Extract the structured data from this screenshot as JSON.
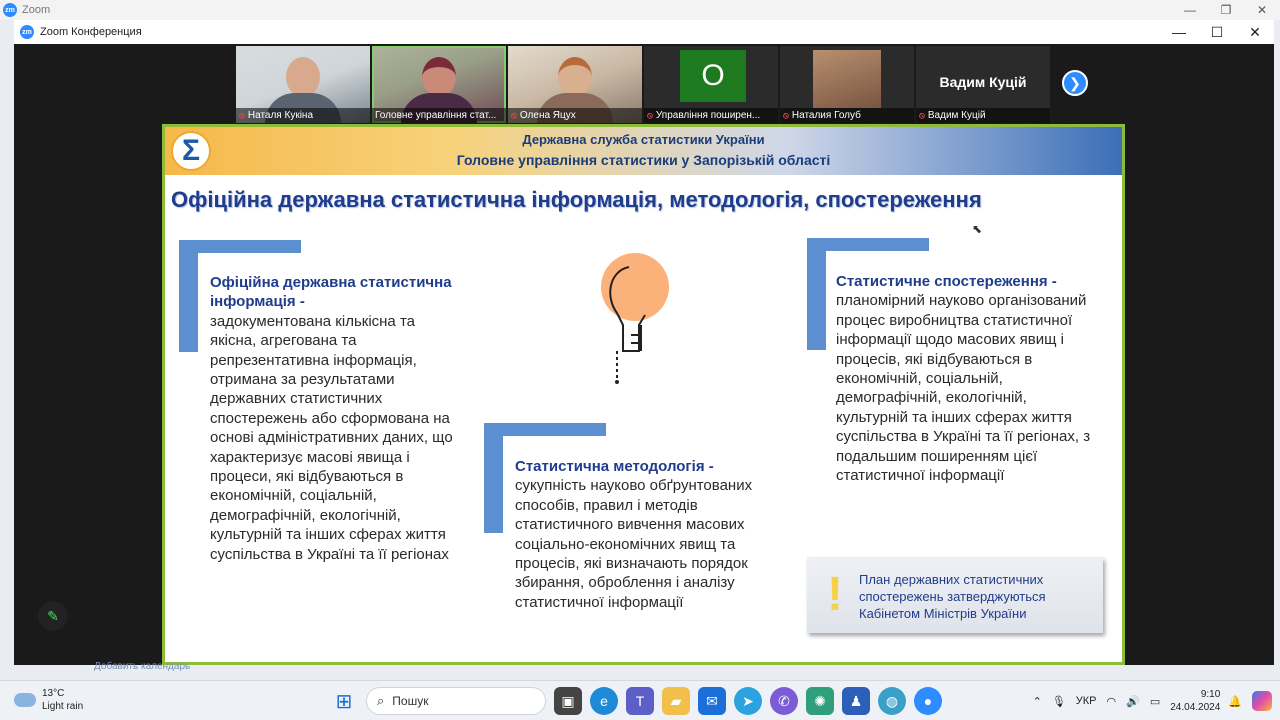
{
  "outer_window": {
    "title": "Zoom"
  },
  "meeting_window": {
    "title": "Zoom Конференция"
  },
  "participants": [
    {
      "name": "Наталя Кукіна"
    },
    {
      "name": "Головне управління стат..."
    },
    {
      "name": "Олена Яцух"
    },
    {
      "name": "Управління поширен...",
      "initial": "О"
    },
    {
      "name": "Наталия Голуб"
    },
    {
      "name": "Вадим Куцій",
      "display_name": "Вадим Куцій"
    }
  ],
  "slide": {
    "org_line1": "Державна служба статистики України",
    "org_line2": "Головне управління статистики у Запорізькій області",
    "title": "Офіційна державна статистична інформація, методологія, спостереження",
    "col1_term": "Офіційна державна статистична інформація -",
    "col1_text": "задокументована кількісна та якісна, агрегована та репрезентативна інформація, отримана за результатами державних статистичних спостережень або сформована на основі адміністративних даних, що характеризує масові явища і процеси, які відбуваються в економічній, соціальній, демографічній, екологічній, культурній та інших сферах життя суспільства в Україні та її регіонах",
    "col2_term": "Статистична методологія -",
    "col2_text": "сукупність науково обґрунтованих способів, правил і методів статистичного вивчення масових соціально-економічних явищ та процесів, які визначають порядок збирання, оброблення і аналізу статистичної інформації",
    "col3_term": "Статистичне спостереження -",
    "col3_text": "планомірний науково організований процес виробництва статистичної інформації щодо масових явищ і процесів, які відбуваються в економічній, соціальній, демографічній, екологічній, культурній та інших сферах життя суспільства в Україні та її регіонах, з подальшим поширенням цієї статистичної інформації",
    "note_text": "План державних статистичних спостережень затверджуються Кабінетом Міністрів України"
  },
  "behind_text": "Добавить календарь",
  "taskbar": {
    "weather_temp": "13°C",
    "weather_desc": "Light rain",
    "search_placeholder": "Пошук",
    "language": "УКР",
    "time": "9:10",
    "date": "24.04.2024"
  },
  "colors": {
    "slide_border": "#8dbb3a",
    "slide_title": "#1f3d8c",
    "bracket": "#5b8fd0",
    "bulb": "#fbb17a",
    "zoom_blue": "#2d8cff"
  }
}
